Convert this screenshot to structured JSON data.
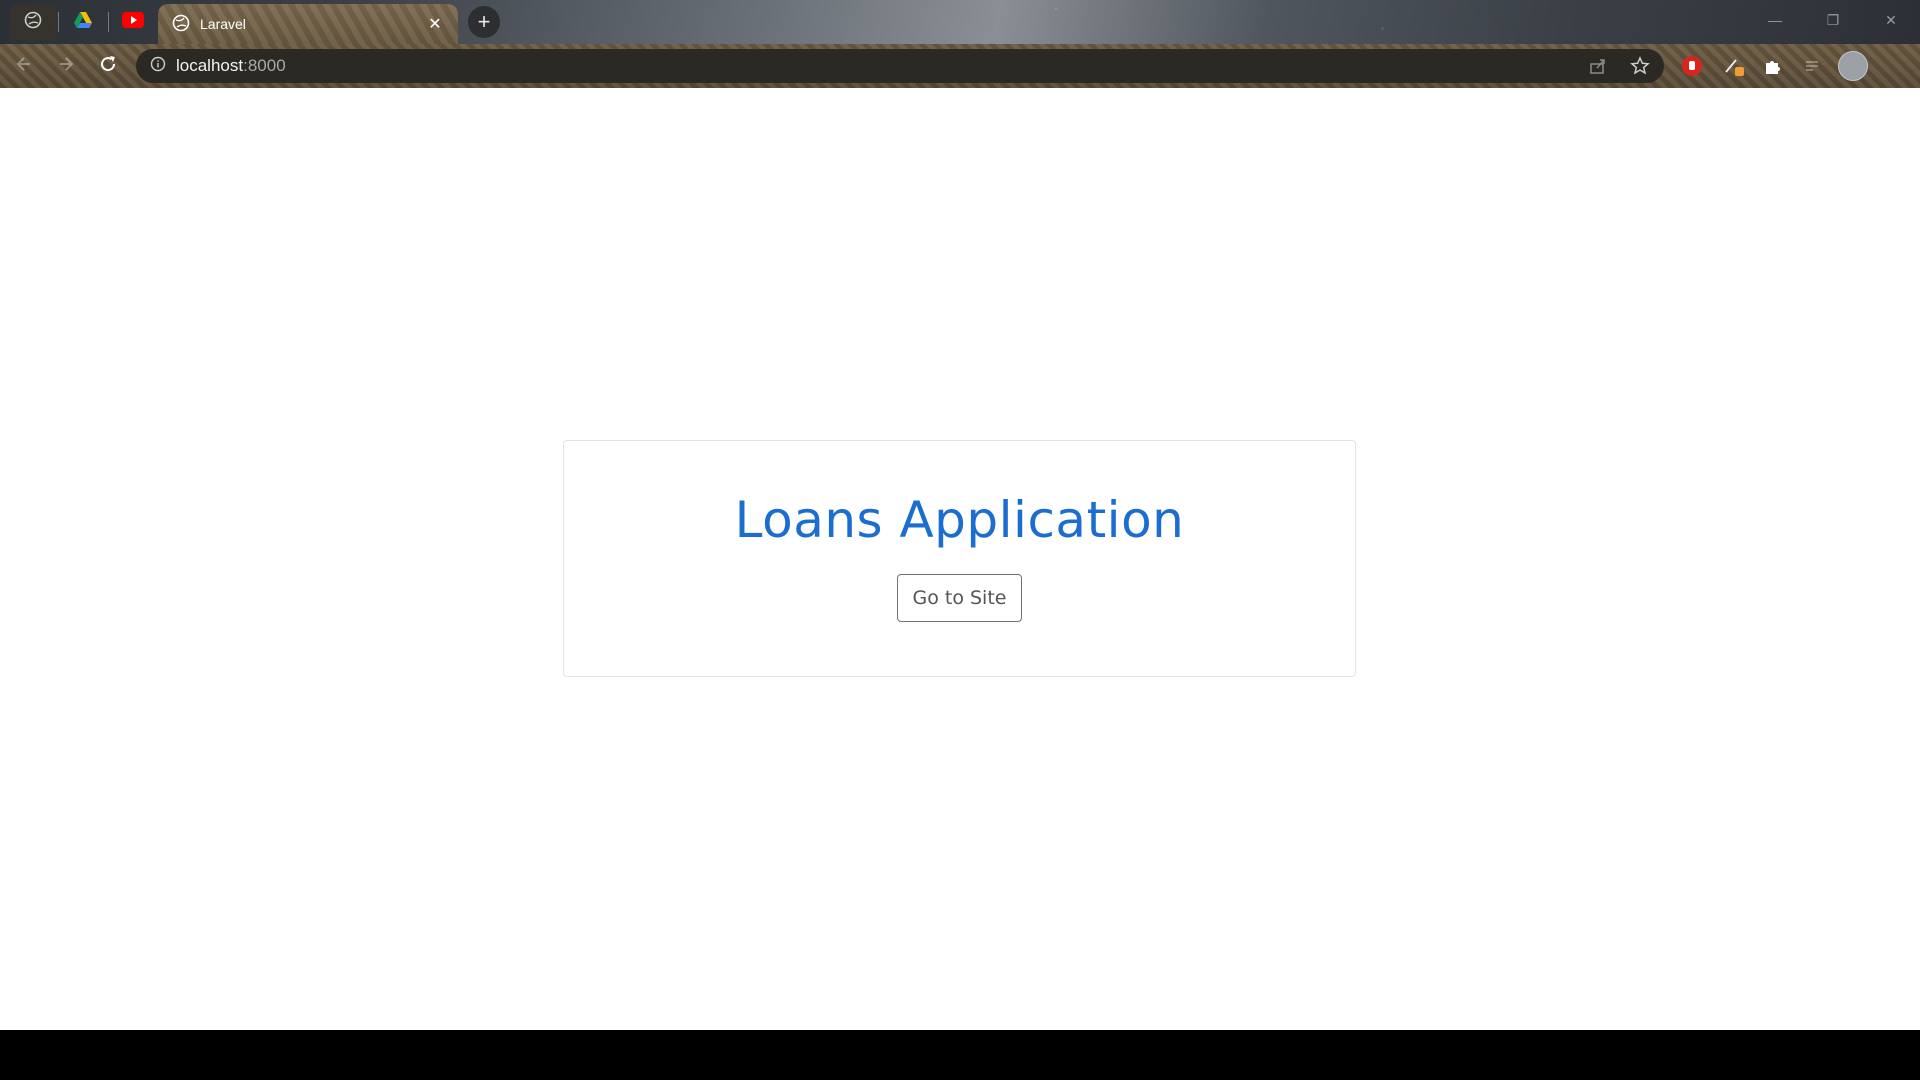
{
  "browser": {
    "pinned_tabs": [
      "globe-icon",
      "google-drive-icon",
      "youtube-icon"
    ],
    "active_tab": {
      "title": "Laravel",
      "close_glyph": "✕"
    },
    "new_tab_glyph": "+",
    "url": {
      "host": "localhost",
      "port": ":8000"
    },
    "colors": {
      "omnibox": "#2b2924",
      "toolbar": "#5c4d38"
    }
  },
  "page": {
    "heading": "Loans Application",
    "button_label": "Go to Site",
    "colors": {
      "heading": "#1c6dd0",
      "button_border": "#6c757d"
    }
  }
}
